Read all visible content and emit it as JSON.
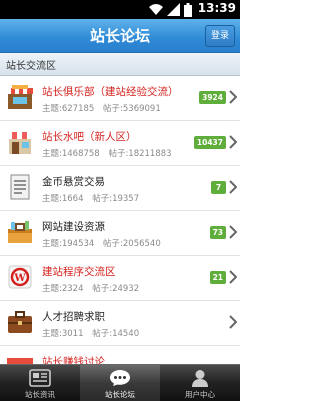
{
  "status_bar": {
    "time": "13:39"
  },
  "header": {
    "title": "站长论坛",
    "login_label": "登录"
  },
  "section": {
    "title": "站长交流区"
  },
  "forums": [
    {
      "name": "站长俱乐部（建站经验交流）",
      "name_color": "red",
      "topics_label": "主题:627185",
      "posts_label": "帖子:5369091",
      "badge": "3924",
      "icon": "shop-icon"
    },
    {
      "name": "站长水吧（新人区）",
      "name_color": "red",
      "topics_label": "主题:1468758",
      "posts_label": "帖子:18211883",
      "badge": "10437",
      "icon": "store-icon"
    },
    {
      "name": "金币悬赏交易",
      "name_color": "dark",
      "topics_label": "主题:1664",
      "posts_label": "帖子:19357",
      "badge": "7",
      "icon": "document-icon"
    },
    {
      "name": "网站建设资源",
      "name_color": "dark",
      "topics_label": "主题:194534",
      "posts_label": "帖子:2056540",
      "badge": "73",
      "icon": "toolbox-icon"
    },
    {
      "name": "建站程序交流区",
      "name_color": "red",
      "topics_label": "主题:2324",
      "posts_label": "帖子:24932",
      "badge": "21",
      "icon": "wordpress-icon"
    },
    {
      "name": "人才招聘求职",
      "name_color": "dark",
      "topics_label": "主题:3011",
      "posts_label": "帖子:14540",
      "badge": "",
      "icon": "briefcase-icon"
    },
    {
      "name": "站长赚钱讨论",
      "name_color": "red",
      "topics_label": "",
      "posts_label": "",
      "badge": "",
      "icon": "shop-icon"
    }
  ],
  "tabs": [
    {
      "label": "站长资讯",
      "icon": "news-icon",
      "active": false
    },
    {
      "label": "站长论坛",
      "icon": "chat-icon",
      "active": true
    },
    {
      "label": "用户中心",
      "icon": "user-icon",
      "active": false
    }
  ],
  "colors": {
    "header": "#2f8ad6",
    "badge": "#5fae3b",
    "red_title": "#d4231f"
  }
}
